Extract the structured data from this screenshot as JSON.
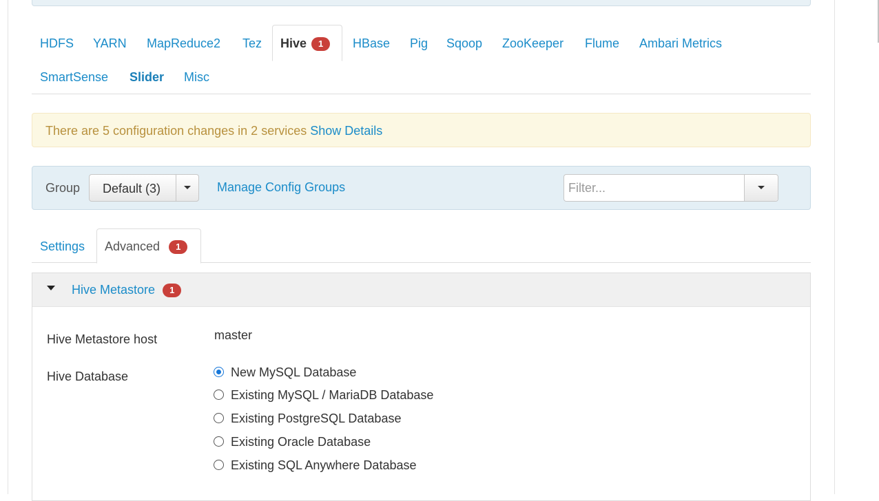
{
  "service_tabs": [
    {
      "label": "HDFS"
    },
    {
      "label": "YARN"
    },
    {
      "label": "MapReduce2"
    },
    {
      "label": "Tez"
    },
    {
      "label": "Hive",
      "badge": "1"
    },
    {
      "label": "HBase"
    },
    {
      "label": "Pig"
    },
    {
      "label": "Sqoop"
    },
    {
      "label": "ZooKeeper"
    },
    {
      "label": "Flume"
    },
    {
      "label": "Ambari Metrics"
    },
    {
      "label": "SmartSense"
    },
    {
      "label": "Slider"
    },
    {
      "label": "Misc"
    }
  ],
  "alert": {
    "text": "There are 5 configuration changes in 2 services",
    "link": "Show Details"
  },
  "group_bar": {
    "label": "Group",
    "selected": "Default (3)",
    "manage_link": "Manage Config Groups",
    "filter_placeholder": "Filter..."
  },
  "sub_tabs": [
    {
      "label": "Settings"
    },
    {
      "label": "Advanced",
      "badge": "1"
    }
  ],
  "section": {
    "title": "Hive Metastore",
    "badge": "1",
    "host_label": "Hive Metastore host",
    "host_value": "master",
    "db_label": "Hive Database",
    "db_options": [
      "New MySQL Database",
      "Existing MySQL / MariaDB Database",
      "Existing PostgreSQL Database",
      "Existing Oracle Database",
      "Existing SQL Anywhere Database"
    ],
    "db_selected": "New MySQL Database"
  }
}
